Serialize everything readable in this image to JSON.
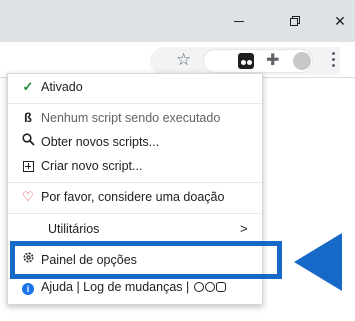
{
  "window_controls": {
    "minimize": "–",
    "maximize": "maximize",
    "close": "✕"
  },
  "toolbar": {
    "bookmark_icon": "star-icon",
    "extension_icon": "tampermonkey-icon",
    "extensions_menu_icon": "puzzle-icon",
    "more_icon": "kebab-icon"
  },
  "menu": {
    "items": [
      {
        "icon": "check-icon",
        "label": "Ativado"
      },
      {
        "icon": "script-icon",
        "label": "Nenhum script sendo executado"
      },
      {
        "icon": "search-icon",
        "label": "Obter novos scripts..."
      },
      {
        "icon": "add-box-icon",
        "label": "Criar novo script..."
      },
      {
        "icon": "heart-icon",
        "label": "Por favor, considere uma doação"
      },
      {
        "icon": "",
        "label": "Utilitários",
        "submenu_arrow": ">"
      },
      {
        "icon": "gear-icon",
        "label": "Painel de opções"
      },
      {
        "icon": "info-icon",
        "label": "Ajuda | Log de mudanças |"
      }
    ]
  },
  "annotation": {
    "highlight_color": "#1769c7"
  }
}
